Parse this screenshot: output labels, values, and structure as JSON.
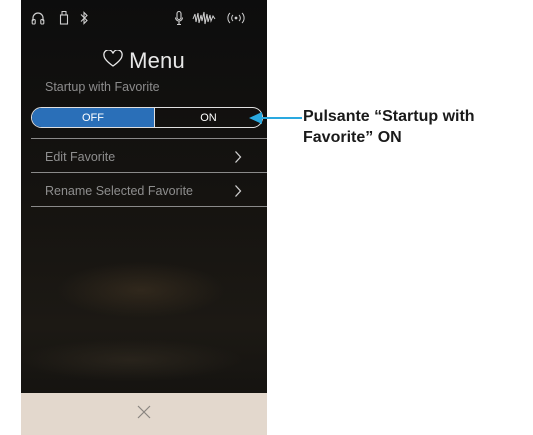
{
  "status_bar": {
    "icons": [
      "headphones-icon",
      "usb-icon",
      "bluetooth-icon",
      "mic-icon",
      "sound-wave-icon",
      "wireless-icon"
    ]
  },
  "header": {
    "icon": "heart-icon",
    "title": "Menu"
  },
  "startup": {
    "label": "Startup with Favorite",
    "off_label": "OFF",
    "on_label": "ON",
    "selected": "OFF"
  },
  "menu_items": [
    {
      "label": "Edit Favorite",
      "icon": "chevron-right-icon"
    },
    {
      "label": "Rename Selected Favorite",
      "icon": "chevron-right-icon"
    }
  ],
  "bottom_bar": {
    "icon": "close-icon"
  },
  "callout": {
    "line1": "Pulsante “Startup with",
    "line2": "Favorite” ON",
    "color": "#2aa9e0"
  },
  "colors": {
    "toggle_active": "#2a6fb8",
    "bottom_bar": "#e3d8cd",
    "background": "#151310"
  }
}
